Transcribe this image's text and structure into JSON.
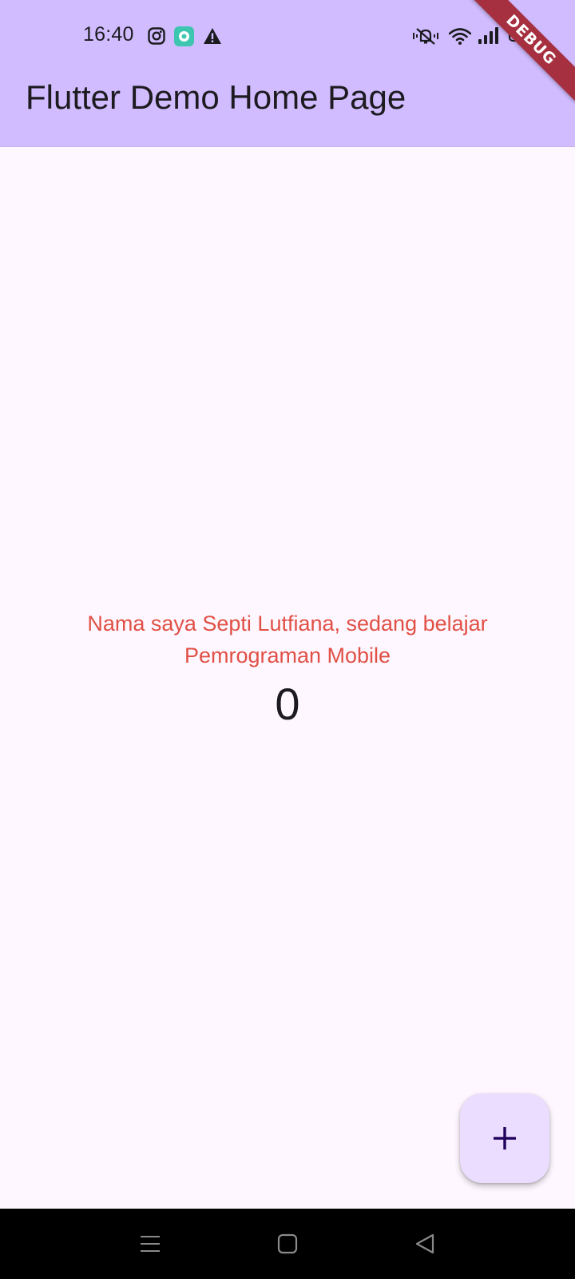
{
  "status_bar": {
    "time": "16:40",
    "battery": "100"
  },
  "app_bar": {
    "title": "Flutter Demo Home Page"
  },
  "debug_banner": {
    "label": "DEBUG"
  },
  "main": {
    "greeting": "Nama saya Septi Lutfiana, sedang belajar Pemrograman Mobile",
    "counter": "0"
  },
  "fab": {
    "icon": "add-icon"
  },
  "navigation": {
    "buttons": [
      "menu-icon",
      "home-icon",
      "back-icon"
    ]
  },
  "colors": {
    "app_bar": "#d1bcff",
    "background": "#fef7ff",
    "greeting_text": "#e05045",
    "fab": "#eaddff",
    "debug_banner": "#a6303f"
  }
}
